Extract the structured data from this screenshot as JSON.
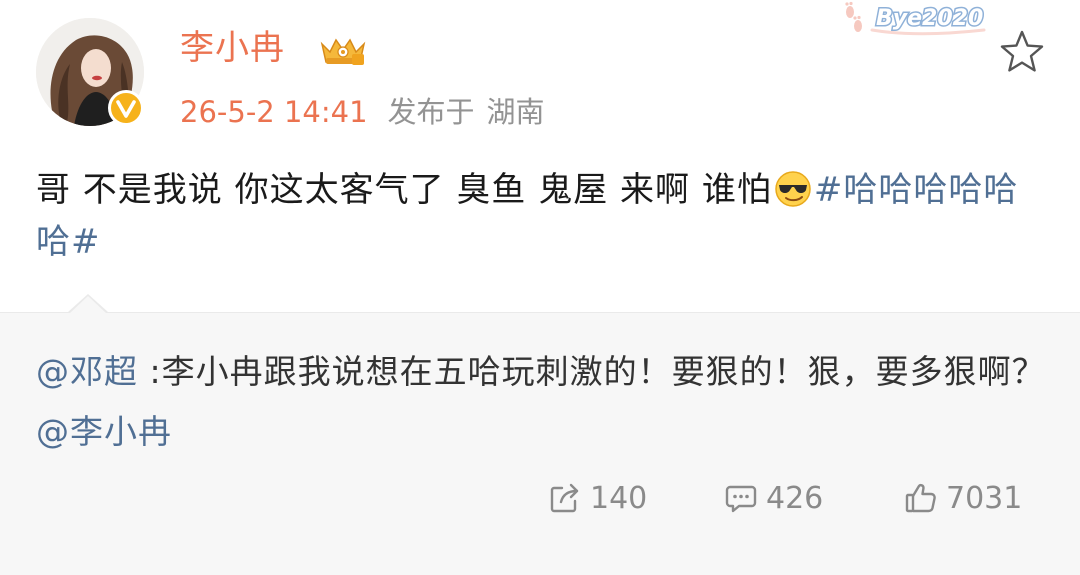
{
  "post": {
    "username": "李小冉",
    "timestamp": "26-5-2 14:41",
    "published_label": "发布于",
    "location": "湖南",
    "sticker_text": "Bye2020",
    "content_text": "哥 不是我说 你这太客气了 臭鱼 鬼屋 来啊 谁怕",
    "emoji_name": "cool-sunglasses-emoji",
    "topic": "#哈哈哈哈哈哈#"
  },
  "repost": {
    "mention_author": "@邓超",
    "text": " :李小冉跟我说想在五哈玩刺激的！要狠的！狠，要多狠啊？",
    "mention_target": "@李小冉"
  },
  "actions": {
    "repost_count": "140",
    "comment_count": "426",
    "like_count": "7031"
  },
  "icons": {
    "verified": "verified-v-icon",
    "vip": "crown-vip-badge-icon",
    "favorite": "star-icon",
    "repost": "share-arrow-icon",
    "comment": "comment-bubble-icon",
    "like": "thumbs-up-icon"
  },
  "colors": {
    "username": "#eb7350",
    "timestamp": "#eb7350",
    "link": "#506f94",
    "meta_gray": "#939393",
    "repost_bg": "#f7f7f7"
  }
}
